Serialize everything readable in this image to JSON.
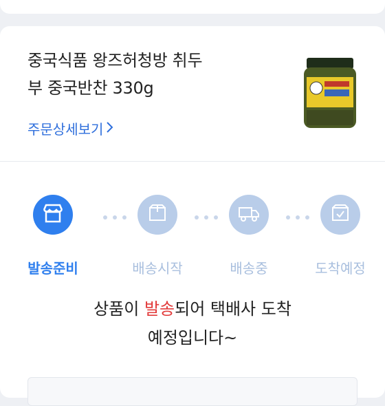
{
  "product": {
    "name_line1": "중국식품 왕즈허청방 취두",
    "name_line2": "부 중국반찬 330g",
    "order_detail_label": "주문상세보기",
    "image_alt": "product-jar"
  },
  "steps": [
    {
      "label": "발송준비",
      "icon": "store-icon",
      "state": "active"
    },
    {
      "label": "배송시작",
      "icon": "box-icon",
      "state": "inactive"
    },
    {
      "label": "배송중",
      "icon": "truck-icon",
      "state": "inactive"
    },
    {
      "label": "도착예정",
      "icon": "check-box-icon",
      "state": "inactive"
    }
  ],
  "message": {
    "prefix": "상품이 ",
    "highlight": "발송",
    "suffix": "되어 택배사 도착",
    "line2": "예정입니다~"
  },
  "colors": {
    "accent": "#2f7fee",
    "inactive": "#b9cde9",
    "highlight": "#e23b3b",
    "link": "#2f6fdc"
  }
}
